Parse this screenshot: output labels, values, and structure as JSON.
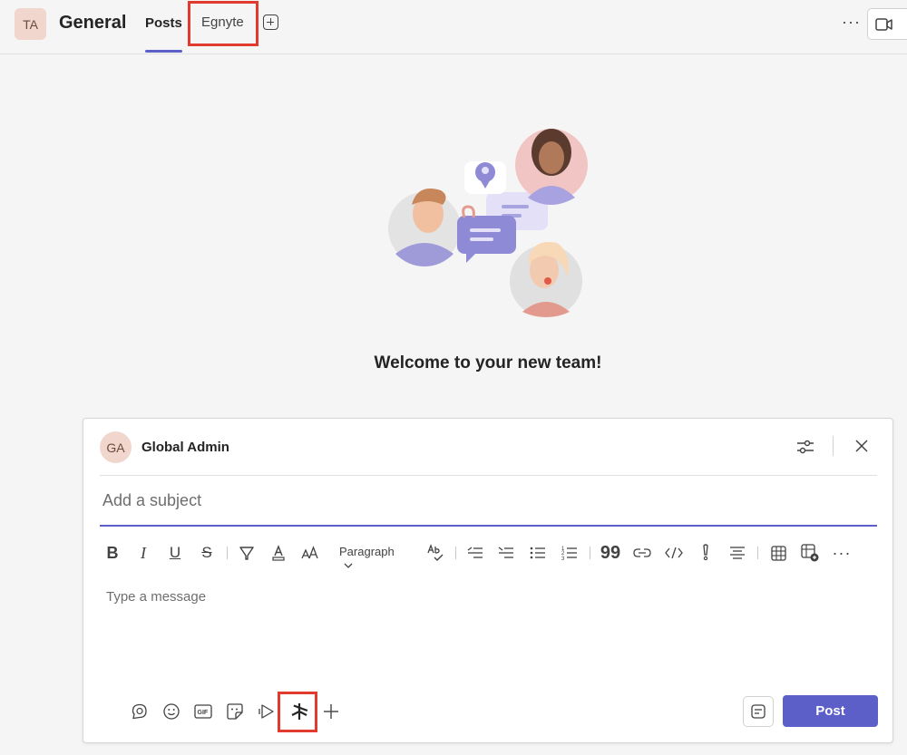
{
  "header": {
    "team_initials": "TA",
    "channel_name": "General",
    "tabs": [
      {
        "label": "Posts",
        "active": true
      },
      {
        "label": "Egnyte",
        "active": false,
        "highlighted": true
      }
    ],
    "more_label": "···"
  },
  "welcome": {
    "text": "Welcome to your new team!"
  },
  "compose": {
    "author_initials": "GA",
    "author_name": "Global Admin",
    "subject_placeholder": "Add a subject",
    "toolbar": {
      "paragraph_label": "Paragraph",
      "buttons": [
        "bold",
        "italic",
        "underline",
        "strikethrough",
        "highlight",
        "font-color",
        "font-size",
        "paragraph-style",
        "spell-check",
        "decrease-indent",
        "increase-indent",
        "bulleted-list",
        "numbered-list",
        "quote",
        "link",
        "code",
        "important",
        "align",
        "table",
        "insert-table",
        "more"
      ]
    },
    "message_placeholder": "Type a message",
    "bottom_actions": [
      "loop",
      "emoji",
      "gif",
      "sticker",
      "stream",
      "egnyte-app",
      "add"
    ],
    "highlighted_action": "egnyte-app",
    "post_label": "Post"
  },
  "colors": {
    "accent": "#5b5fc7",
    "highlight_box": "#e03b2e",
    "avatar_bg": "#f1d6cd"
  }
}
